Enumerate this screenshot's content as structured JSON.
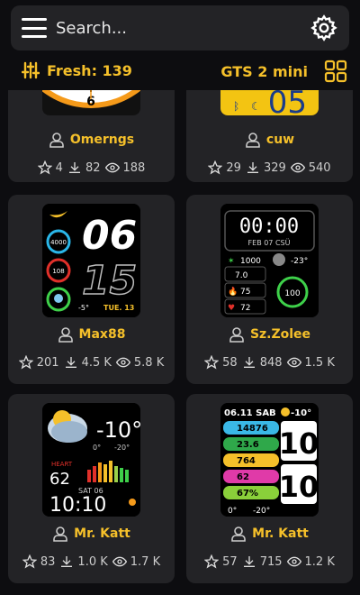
{
  "search": {
    "placeholder": "Search..."
  },
  "filter": {
    "fresh_label": "Fresh: 139",
    "model": "GTS 2 mini"
  },
  "cards": [
    {
      "author": "Omerngs",
      "stars": "4",
      "downloads": "82",
      "views": "188"
    },
    {
      "author": "cuw",
      "stars": "29",
      "downloads": "329",
      "views": "540"
    },
    {
      "author": "Max88",
      "stars": "201",
      "downloads": "4.5 K",
      "views": "5.8 K"
    },
    {
      "author": "Sz.Zolee",
      "stars": "58",
      "downloads": "848",
      "views": "1.5 K"
    },
    {
      "author": "Mr. Katt",
      "stars": "83",
      "downloads": "1.0 K",
      "views": "1.7 K"
    },
    {
      "author": "Mr. Katt",
      "stars": "57",
      "downloads": "715",
      "views": "1.2 K"
    }
  ],
  "faces": {
    "f2": {
      "hour": "05"
    },
    "f3": {
      "h": "06",
      "m": "15",
      "steps": "4000",
      "hr": "108",
      "temp": "-5°",
      "date": "TUE. 13"
    },
    "f4": {
      "time": "00:00",
      "date": "FEB 07 CSÜ",
      "steps": "1000",
      "temp": "-23°",
      "dist": "7.0",
      "v1": "75",
      "v2": "72",
      "batt": "100"
    },
    "f5": {
      "temp": "-10°",
      "lo": "0°",
      "hi": "-20°",
      "heart_label": "HEART",
      "heart": "62",
      "date": "SAT 06",
      "time": "10:10"
    },
    "f6": {
      "date": "06.11 SAB",
      "temp": "-10°",
      "r1": "14876",
      "r2": "23.6",
      "r3": "764",
      "r4": "62",
      "r5": "67%",
      "h": "10",
      "m": "10",
      "lo": "0°",
      "hi": "-20°"
    }
  },
  "colors": {
    "accent": "#f5c02a",
    "card": "#232326",
    "bg": "#0d0d10"
  }
}
